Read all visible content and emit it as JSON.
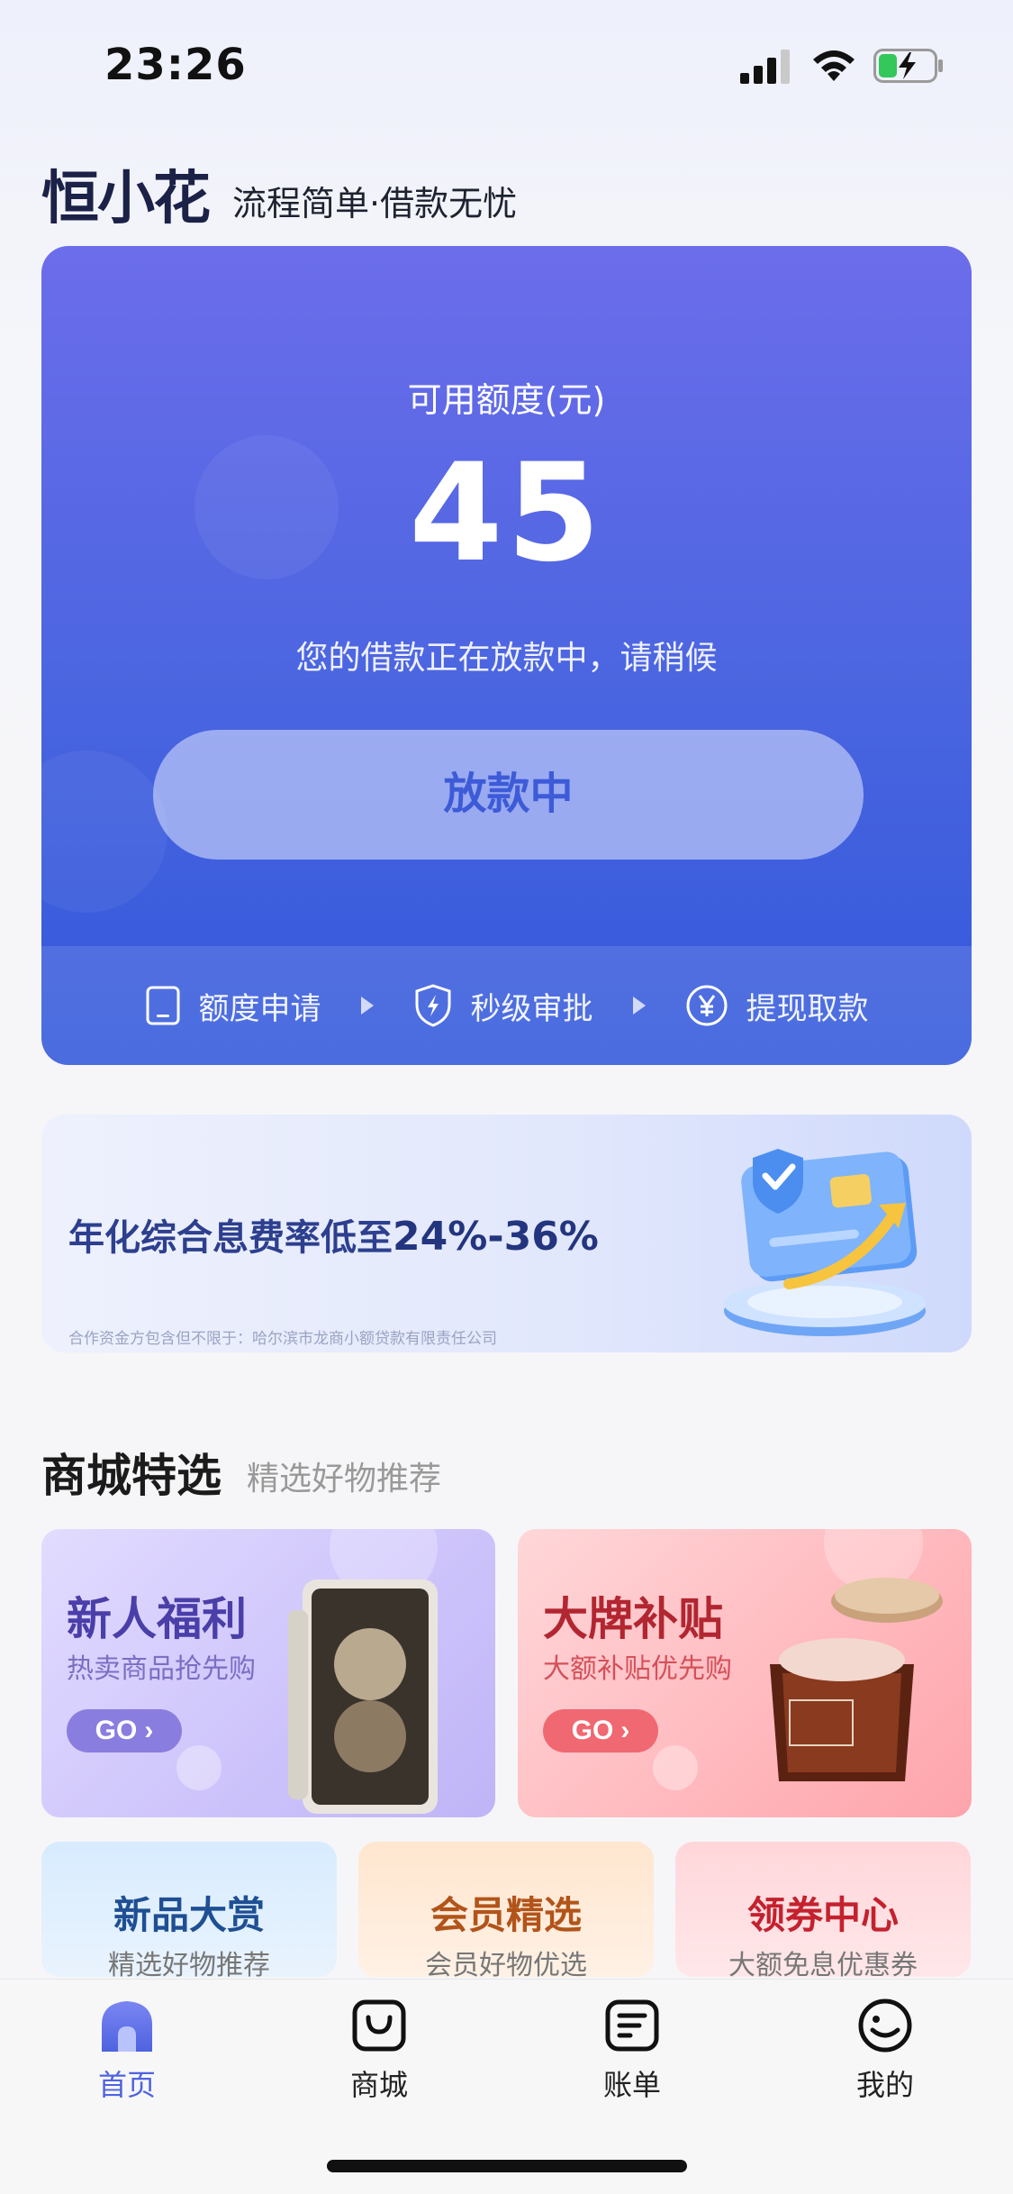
{
  "status_bar": {
    "time": "23:26"
  },
  "brand": {
    "logo": "恒小花",
    "slogan": "流程简单·借款无忧"
  },
  "credit_card": {
    "label": "可用额度(元)",
    "amount": "45",
    "status": "您的借款正在放款中，请稍候",
    "button": "放款中",
    "steps": [
      {
        "label": "额度申请",
        "icon": "phone-icon"
      },
      {
        "label": "秒级审批",
        "icon": "shield-bolt-icon"
      },
      {
        "label": "提现取款",
        "icon": "yen-icon"
      }
    ]
  },
  "rate_banner": {
    "text_prefix": "年化综合息费率低至",
    "text_highlight": "24%-36%",
    "note": "合作资金方包含但不限于：哈尔滨市龙商小额贷款有限责任公司"
  },
  "mall": {
    "title": "商城特选",
    "subtitle": "精选好物推荐",
    "promos": [
      {
        "title": "新人福利",
        "subtitle": "热卖商品抢先购",
        "button": "GO"
      },
      {
        "title": "大牌补贴",
        "subtitle": "大额补贴优先购",
        "button": "GO"
      }
    ],
    "tiles": [
      {
        "title": "新品大赏",
        "subtitle": "精选好物推荐"
      },
      {
        "title": "会员精选",
        "subtitle": "会员好物优选"
      },
      {
        "title": "领券中心",
        "subtitle": "大额免息优惠券"
      }
    ]
  },
  "tabbar": {
    "items": [
      {
        "label": "首页",
        "icon": "home-icon",
        "active": true
      },
      {
        "label": "商城",
        "icon": "shopping-bag-icon"
      },
      {
        "label": "账单",
        "icon": "bill-icon"
      },
      {
        "label": "我的",
        "icon": "smile-icon"
      }
    ]
  },
  "colors": {
    "accent": "#4e63e0",
    "card_top": "#6c6deb",
    "card_bottom": "#3258db"
  }
}
